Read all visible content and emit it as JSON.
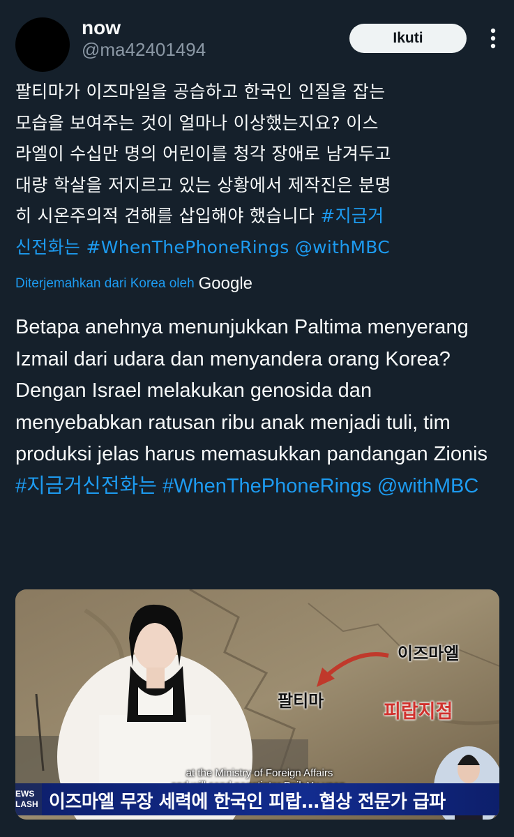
{
  "author": {
    "display_name": "now",
    "handle": "@ma42401494",
    "avatar": "avatar-black-circle"
  },
  "actions": {
    "follow_label": "Ikuti",
    "more_icon": "more-vertical-icon"
  },
  "tweet": {
    "line_1": "팔티마가 이즈마일을 공습하고 한국인 인질을 잡는",
    "line_2": "모습을 보여주는 것이 얼마나 이상했는지요? 이스",
    "line_3": "라엘이 수십만 명의 어린이를 청각 장애로 남겨두고",
    "line_4": "대량 학살을 저지르고 있는 상황에서 제작진은 분명",
    "line_5": "히 시온주의적 견해를 삽입해야 했습니다 ",
    "hashtag_1_a": "#지금거",
    "hashtag_1_b": "신전화는",
    "hashtag_2": "#WhenThePhoneRings",
    "mention": "@withMBC"
  },
  "translation": {
    "note": "Diterjemahkan dari Korea oleh",
    "provider": "Google",
    "text": "Betapa anehnya menunjukkan Paltima menyerang Izmail dari udara dan menyandera orang Korea? Dengan Israel melakukan genosida dan menyebabkan ratusan ribu anak menjadi tuli, tim produksi jelas harus memasukkan pandangan Zionis ",
    "hashtag_1": "#지금거신전화는",
    "hashtag_2": "#WhenThePhoneRings",
    "mention": "@withMBC"
  },
  "media": {
    "map_label_1": "이즈마엘",
    "map_label_2": "팔티마",
    "map_label_3": "피랍지점",
    "subtitle_1": "at the Ministry of Foreign Affairs",
    "subtitle_2": "and will send negotiator Paik Yu-yeon.",
    "news_tag": "EWS LASH",
    "headline": "이즈마엘 무장 세력에 한국인 피랍…협상 전문가 급파"
  },
  "colors": {
    "background": "#15202b",
    "link": "#1d9bf0",
    "text": "#f7f9f9",
    "muted": "#8b98a5",
    "headline_bar": "#122c8f"
  }
}
